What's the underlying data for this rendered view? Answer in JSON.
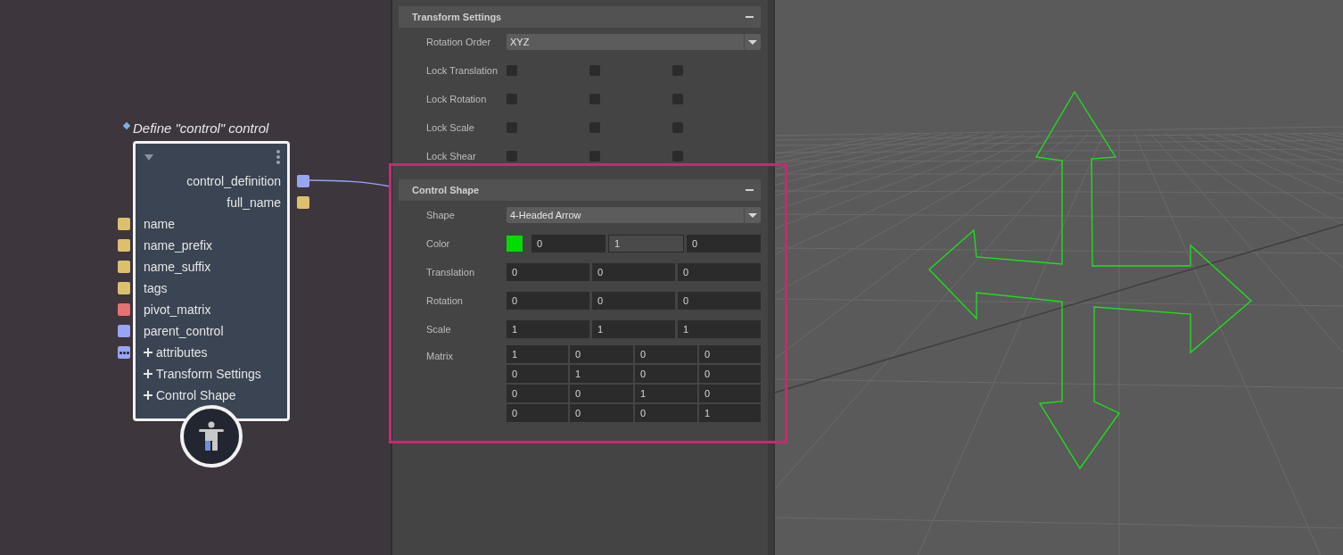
{
  "node": {
    "title": "Define \"control\" control",
    "outputs": [
      {
        "label": "control_definition",
        "color": "#98a4f4"
      },
      {
        "label": "full_name",
        "color": "#dcc06e"
      }
    ],
    "inputs": [
      {
        "label": "name",
        "kind": "port",
        "color": "#dcc06e"
      },
      {
        "label": "name_prefix",
        "kind": "port",
        "color": "#dcc06e"
      },
      {
        "label": "name_suffix",
        "kind": "port",
        "color": "#dcc06e"
      },
      {
        "label": "tags",
        "kind": "port",
        "color": "#dcc06e"
      },
      {
        "label": "pivot_matrix",
        "kind": "port",
        "color": "#e87070"
      },
      {
        "label": "parent_control",
        "kind": "port",
        "color": "#98a4f4"
      },
      {
        "label": "attributes",
        "kind": "group",
        "color": "#98a4f4"
      },
      {
        "label": "Transform Settings",
        "kind": "group"
      },
      {
        "label": "Control Shape",
        "kind": "group"
      }
    ]
  },
  "transform_settings": {
    "title": "Transform Settings",
    "rotation_order": {
      "label": "Rotation Order",
      "value": "XYZ"
    },
    "locks": [
      {
        "label": "Lock Translation",
        "checked": [
          false,
          false,
          false
        ]
      },
      {
        "label": "Lock Rotation",
        "checked": [
          false,
          false,
          false
        ]
      },
      {
        "label": "Lock Scale",
        "checked": [
          false,
          false,
          false
        ]
      },
      {
        "label": "Lock Shear",
        "checked": [
          false,
          false,
          false
        ]
      }
    ]
  },
  "control_shape": {
    "title": "Control Shape",
    "highlighted": true,
    "shape": {
      "label": "Shape",
      "value": "4-Headed Arrow"
    },
    "color": {
      "label": "Color",
      "fields": [
        {
          "value": "0",
          "focused": false
        },
        {
          "value": "1",
          "focused": true
        },
        {
          "value": "0",
          "focused": false
        }
      ]
    },
    "vectors": [
      {
        "label": "Translation",
        "values": [
          "0",
          "0",
          "0"
        ]
      },
      {
        "label": "Rotation",
        "values": [
          "0",
          "0",
          "0"
        ]
      },
      {
        "label": "Scale",
        "values": [
          "1",
          "1",
          "1"
        ]
      }
    ],
    "matrix": {
      "label": "Matrix",
      "rows": [
        [
          "1",
          "0",
          "0",
          "0"
        ],
        [
          "0",
          "1",
          "0",
          "0"
        ],
        [
          "0",
          "0",
          "1",
          "0"
        ],
        [
          "0",
          "0",
          "0",
          "1"
        ]
      ]
    }
  }
}
